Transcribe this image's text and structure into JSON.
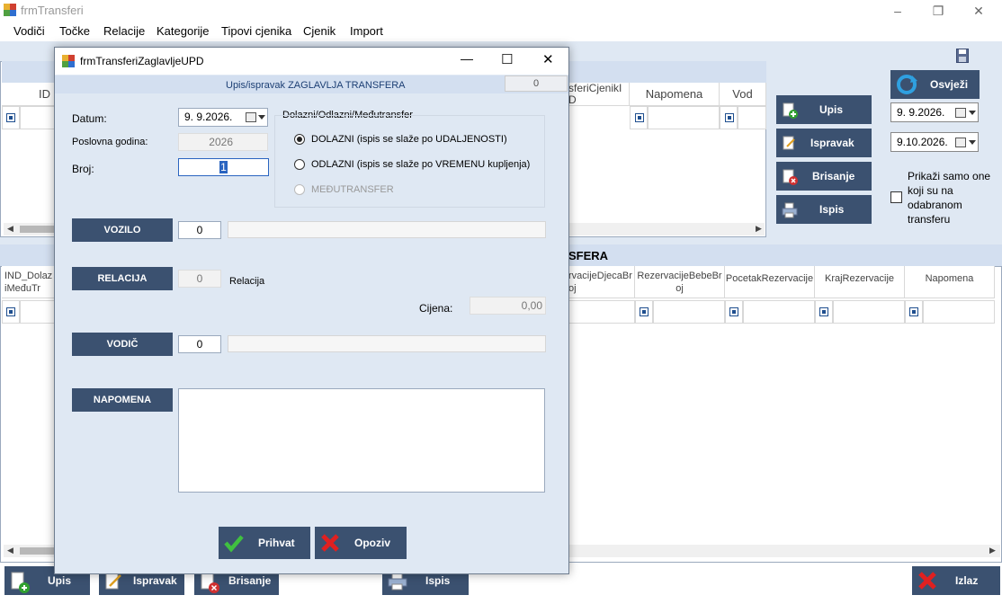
{
  "window": {
    "title": "frmTransferi",
    "controls": {
      "minimize": "–",
      "restore": "❐",
      "close": "✕"
    }
  },
  "menu": [
    "Vodiči",
    "Točke",
    "Relacije",
    "Kategorije",
    "Tipovi cjenika",
    "Cjenik",
    "Import"
  ],
  "grid1": {
    "headers": [
      "ID",
      "sferiCjenikI D",
      "Napomena",
      "Vod"
    ]
  },
  "right_panel": {
    "refresh_label": "Osvježi",
    "upis_label": "Upis",
    "ispravak_label": "Ispravak",
    "brisanje_label": "Brisanje",
    "ispis_label": "Ispis",
    "date_from": "9.  9.2026.",
    "date_to": "9.10.2026.",
    "filter_checkbox_label": "Prikaži samo one koji su na odabranom transferu"
  },
  "grid2": {
    "title": "SFERA",
    "headers": [
      "IND_Dolaz iMeđuTr",
      "rvacijeDjecaBr oj",
      "RezervacijeBebeBr oj",
      "PocetakRezervacije",
      "KrajRezervacije",
      "Napomena"
    ]
  },
  "bottom_toolbar": {
    "upis_label": "Upis",
    "ispravak_label": "Ispravak",
    "brisanje_label": "Brisanje",
    "ispis_label": "Ispis",
    "izlaz_label": "Izlaz"
  },
  "dialog": {
    "title": "frmTransferiZaglavljeUPD",
    "band_text": "Upis/ispravak ZAGLAVLJA TRANSFERA",
    "id_value": "0",
    "controls": {
      "minimize": "—",
      "maximize": "☐",
      "close": "✕"
    },
    "datum_label": "Datum:",
    "datum_value": "9.  9.2026.",
    "poslovna_godina_label": "Poslovna godina:",
    "poslovna_godina_value": "2026",
    "broj_label": "Broj:",
    "broj_value": "1",
    "transfer_type_group_label": "Dolazni/Odlazni/Međutransfer",
    "transfer_types": [
      {
        "label": "DOLAZNI (ispis se slaže po UDALJENOSTI)",
        "selected": true,
        "disabled": false
      },
      {
        "label": "ODLAZNI (ispis se slaže po VREMENU kupljenja)",
        "selected": false,
        "disabled": false
      },
      {
        "label": "MEĐUTRANSFER",
        "selected": false,
        "disabled": true
      }
    ],
    "vozilo_label": "VOZILO",
    "vozilo_value": "0",
    "relacija_label": "RELACIJA",
    "relacija_value": "0",
    "relacija_text": "Relacija",
    "cijena_label": "Cijena:",
    "cijena_value": "0,00",
    "vodic_label": "VODIČ",
    "vodic_value": "0",
    "napomena_label": "NAPOMENA",
    "napomena_value": "",
    "accept_label": "Prihvat",
    "cancel_label": "Opoziv"
  },
  "colors": {
    "button_bg": "#3b5170",
    "panel_bg": "#dfe8f3",
    "band_bg": "#d3dff0"
  }
}
